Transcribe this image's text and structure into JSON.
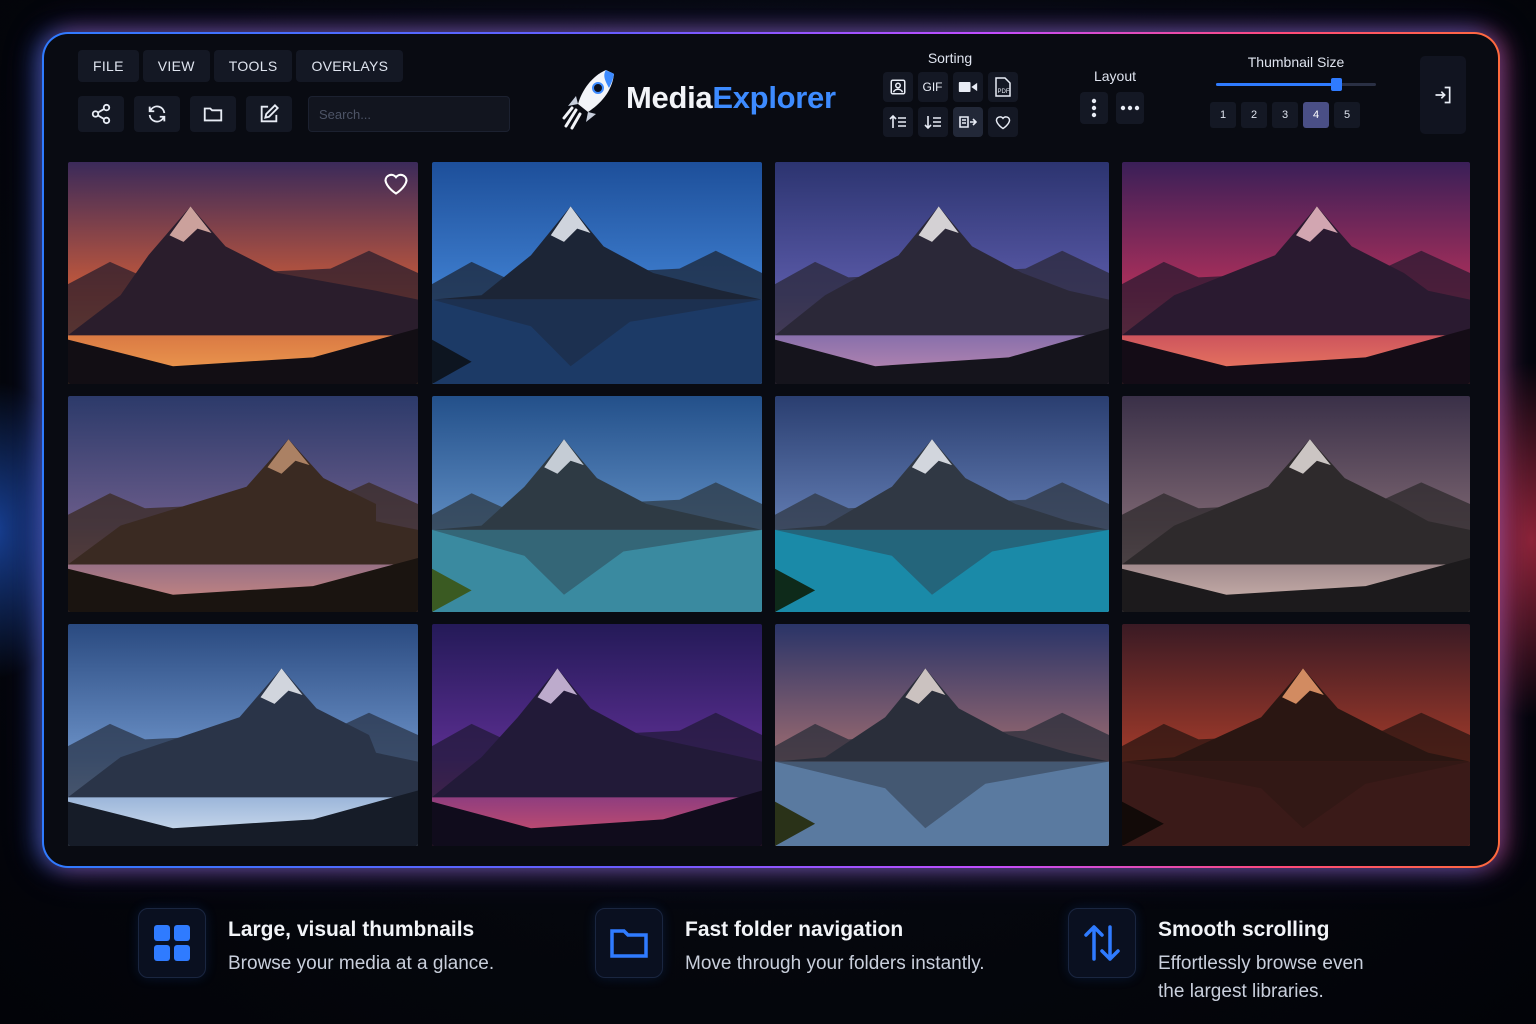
{
  "app": {
    "title_part1": "Media",
    "title_part2": "Explorer"
  },
  "menu": [
    "FILE",
    "VIEW",
    "TOOLS",
    "OVERLAYS"
  ],
  "toolbar": {
    "buttons": [
      "share-icon",
      "refresh-icon",
      "folder-icon",
      "edit-icon"
    ],
    "search_placeholder": "Search..."
  },
  "sorting": {
    "title": "Sorting",
    "row1": [
      {
        "name": "image-filter-icon",
        "label": ""
      },
      {
        "name": "gif-filter",
        "label": "GIF"
      },
      {
        "name": "video-filter-icon",
        "label": ""
      },
      {
        "name": "pdf-filter",
        "label": "PDF"
      }
    ],
    "row2": [
      "sort-ascending-icon",
      "sort-descending-icon",
      "sort-by-name-icon",
      "favorites-filter-icon"
    ],
    "active_index": 6
  },
  "layout": {
    "title": "Layout",
    "options": [
      "vertical-dots-icon",
      "horizontal-dots-icon"
    ]
  },
  "thumbnail_size": {
    "title": "Thumbnail Size",
    "options": [
      "1",
      "2",
      "3",
      "4",
      "5"
    ],
    "selected": "4",
    "slider_fraction": 0.75
  },
  "thumbnails": [
    {
      "scene": "sunset-peak",
      "favorite": true
    },
    {
      "scene": "lake-reflection",
      "favorite": false
    },
    {
      "scene": "matterhorn-dusk",
      "favorite": false
    },
    {
      "scene": "crimson-range",
      "favorite": false
    },
    {
      "scene": "rocky-ridge",
      "favorite": false
    },
    {
      "scene": "green-valley",
      "favorite": false
    },
    {
      "scene": "turquoise-lake",
      "favorite": false
    },
    {
      "scene": "misty-summit",
      "favorite": false
    },
    {
      "scene": "cloud-peaks",
      "favorite": false
    },
    {
      "scene": "violet-dusk",
      "favorite": false
    },
    {
      "scene": "valley-sunset",
      "favorite": false
    },
    {
      "scene": "fiery-reflection",
      "favorite": false
    }
  ],
  "features": [
    {
      "icon": "grid-icon",
      "title": "Large, visual thumbnails",
      "desc": "Browse your media at a glance."
    },
    {
      "icon": "folder-icon",
      "title": "Fast folder navigation",
      "desc": "Move through your folders instantly."
    },
    {
      "icon": "up-down-arrows-icon",
      "title": "Smooth scrolling",
      "desc_line1": "Effortlessly browse even",
      "desc_line2": "the largest libraries."
    }
  ],
  "colors": {
    "accent": "#2f7bff",
    "brand_blue": "#3d8bff",
    "glow_left": "#2f7bff",
    "glow_right": "#ff4a7a"
  }
}
